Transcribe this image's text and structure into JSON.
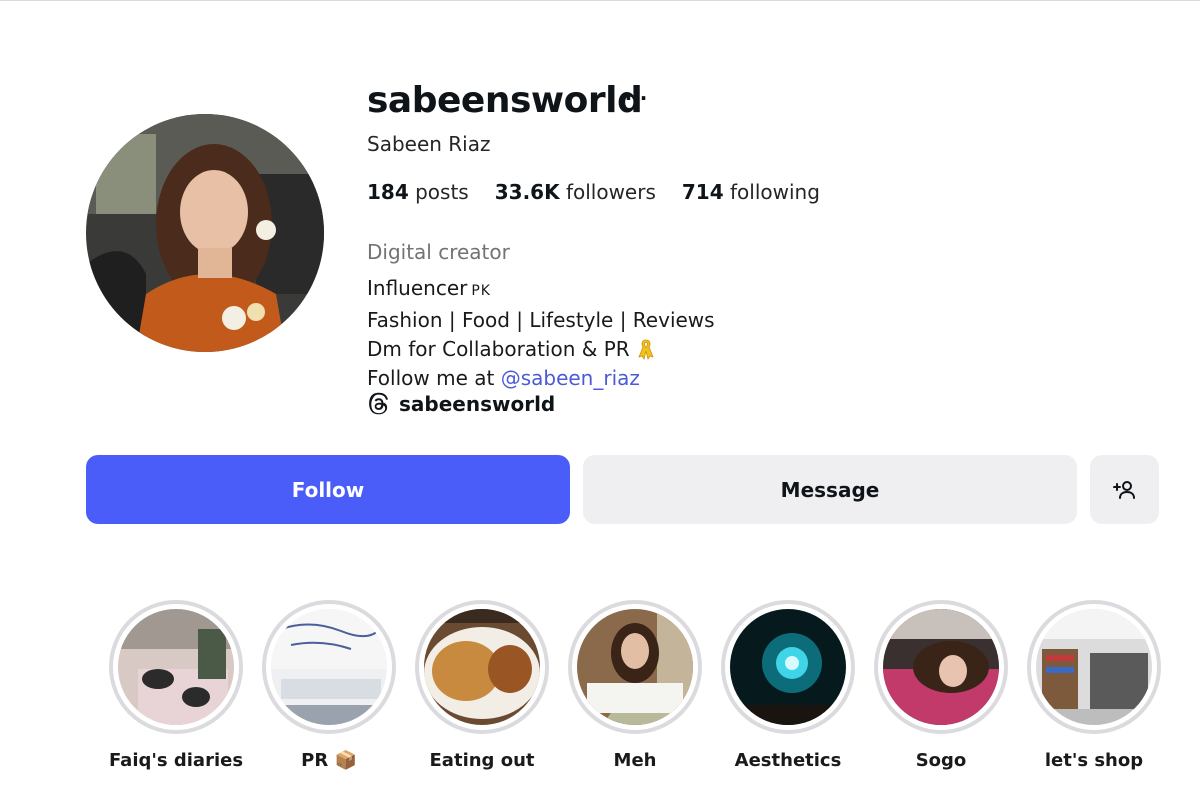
{
  "profile": {
    "username": "sabeensworld",
    "more_label": "···",
    "full_name": "Sabeen Riaz",
    "stats": {
      "posts_value": "184",
      "posts_label": "posts",
      "followers_value": "33.6K",
      "followers_label": "followers",
      "following_value": "714",
      "following_label": "following"
    },
    "category": "Digital creator",
    "bio": {
      "line1": "Influencer",
      "line1_flag": "PK",
      "line2": "Fashion | Food | Lifestyle | Reviews",
      "line3": "Dm for Collaboration & PR",
      "line3_icon": "ribbon-icon",
      "line4_prefix": "Follow me at",
      "line4_link": "@sabeen_riaz"
    },
    "threads": {
      "icon": "threads-icon",
      "handle": "sabeensworld"
    }
  },
  "actions": {
    "follow_label": "Follow",
    "message_label": "Message",
    "add_user_icon": "add-user-icon"
  },
  "highlights": [
    {
      "label": "Faiq's diaries"
    },
    {
      "label": "PR 📦"
    },
    {
      "label": "Eating out"
    },
    {
      "label": "Meh"
    },
    {
      "label": "Aesthetics"
    },
    {
      "label": "Sogo"
    },
    {
      "label": "let's shop"
    }
  ],
  "colors": {
    "follow_button": "#4a5df9",
    "secondary_button": "#efeff2",
    "link": "#4b5bd6",
    "highlight_ring": "#dbdbdf",
    "muted_text": "#737373"
  }
}
